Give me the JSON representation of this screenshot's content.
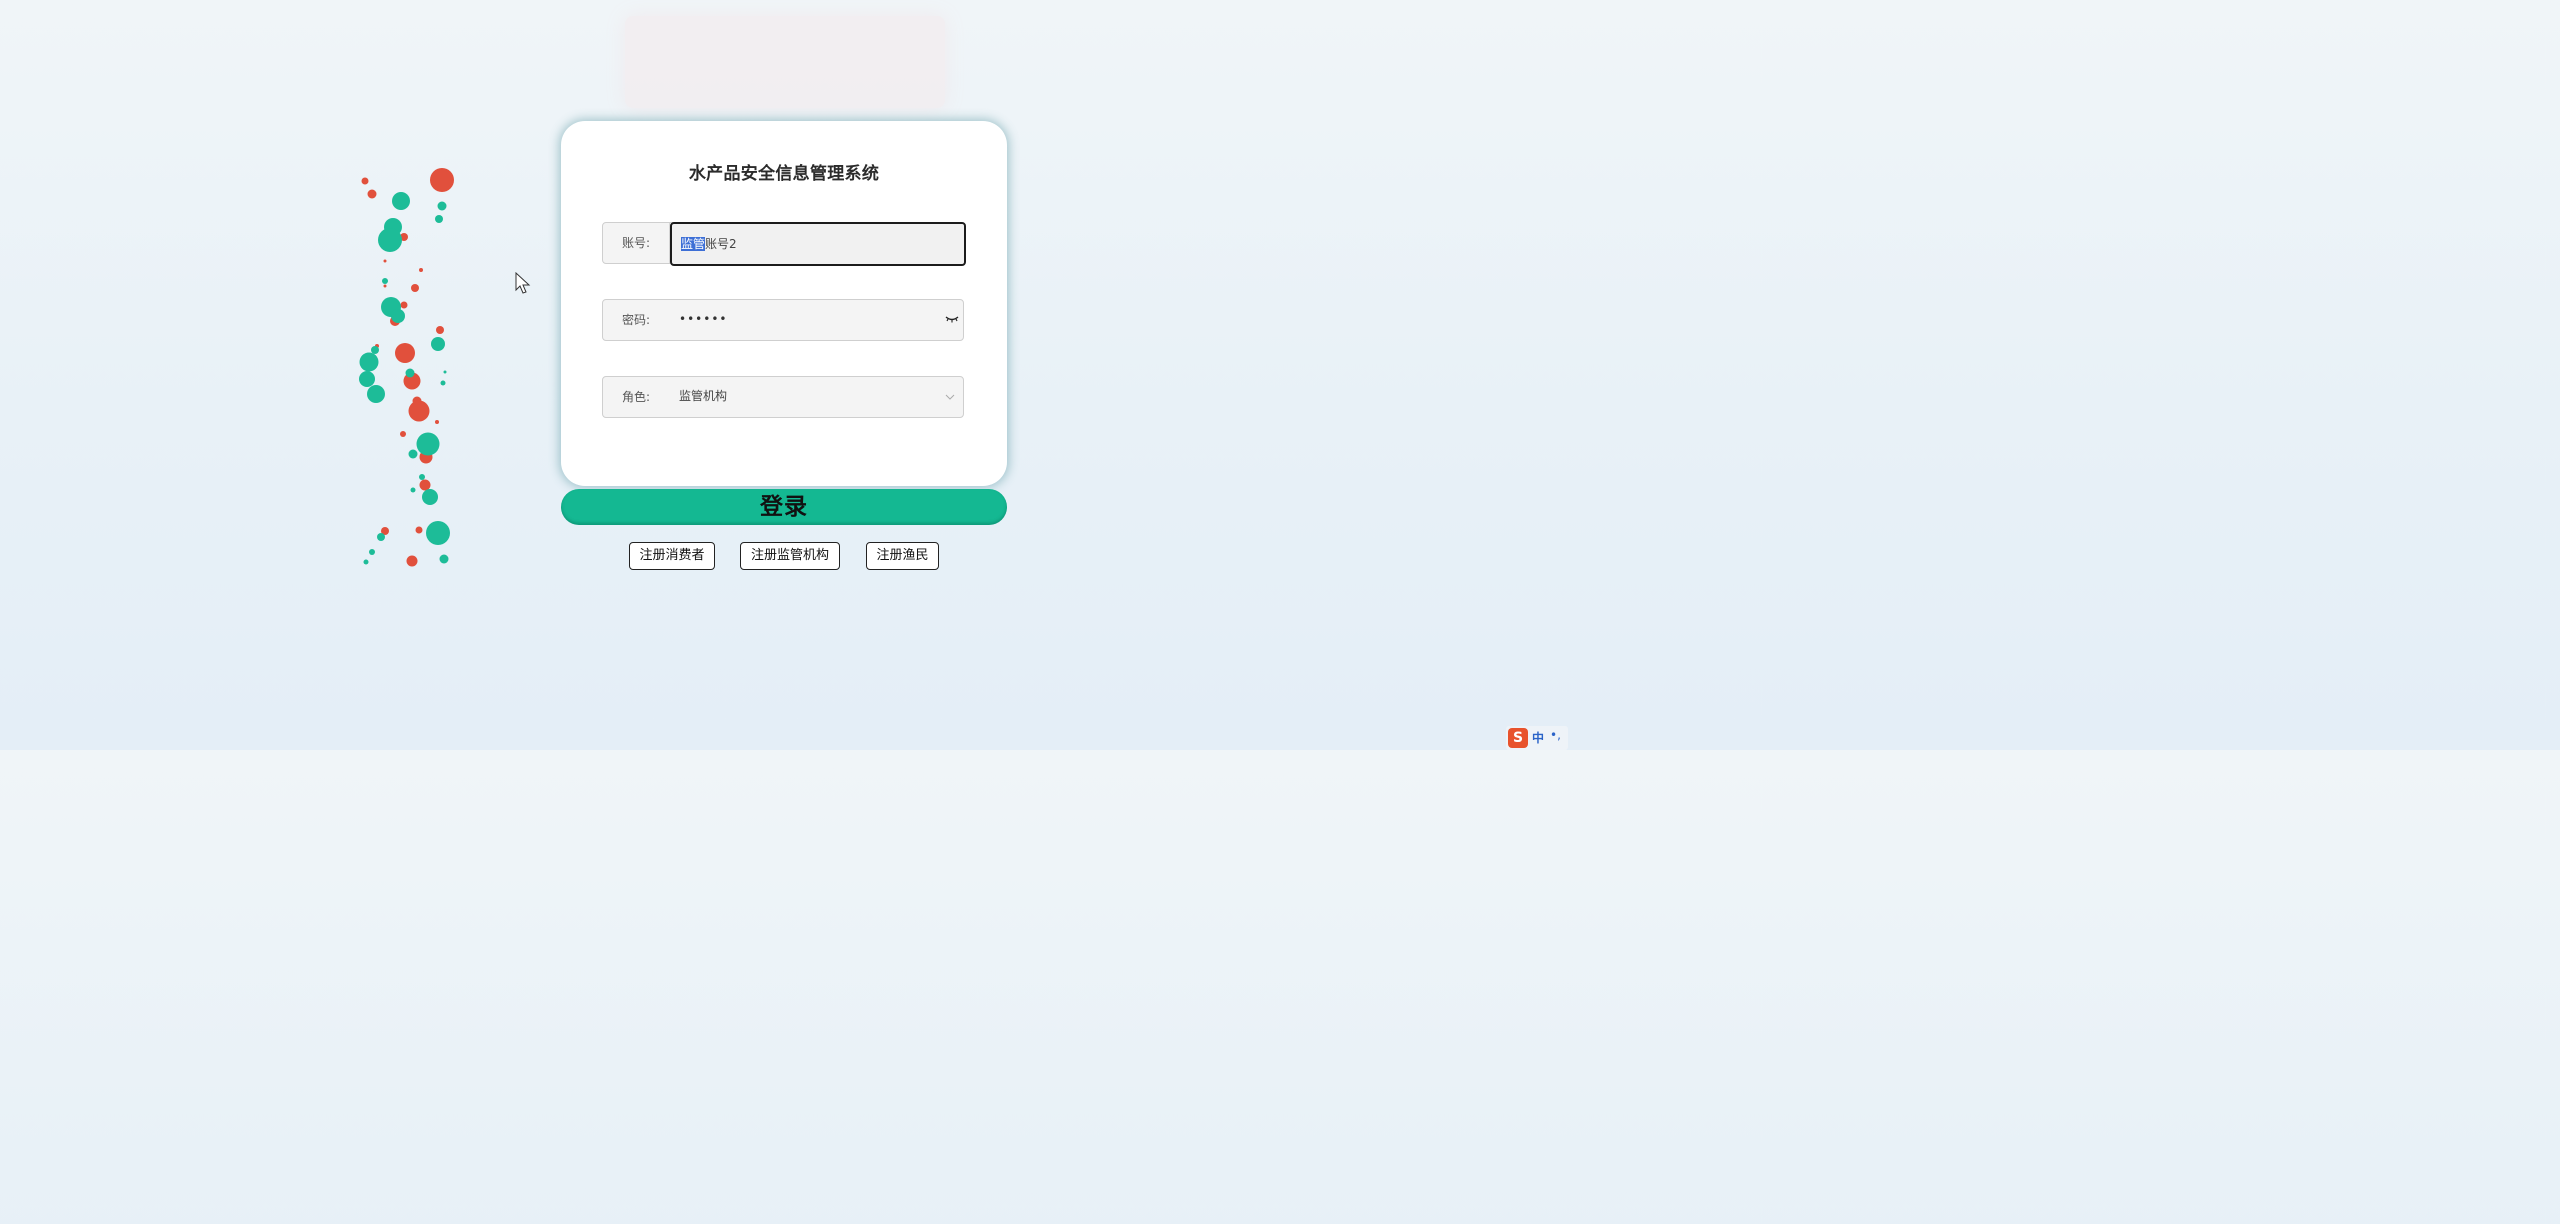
{
  "title": "水产品安全信息管理系统",
  "form": {
    "account": {
      "label": "账号:",
      "value_selected": "监管",
      "value_rest": "账号2"
    },
    "password": {
      "label": "密码:",
      "value_masked": "••••••"
    },
    "role": {
      "label": "角色:",
      "selected": "监管机构"
    }
  },
  "login_button": "登录",
  "register_buttons": {
    "consumer": "注册消费者",
    "regulator": "注册监管机构",
    "fisherman": "注册渔民"
  },
  "ime": {
    "logo": "S",
    "lang": "中",
    "punct": "•,"
  },
  "colors": {
    "accent": "#14b892",
    "bubble_teal": "#1dbc98",
    "bubble_red": "#e1503c",
    "selection": "#3d6fd6"
  }
}
